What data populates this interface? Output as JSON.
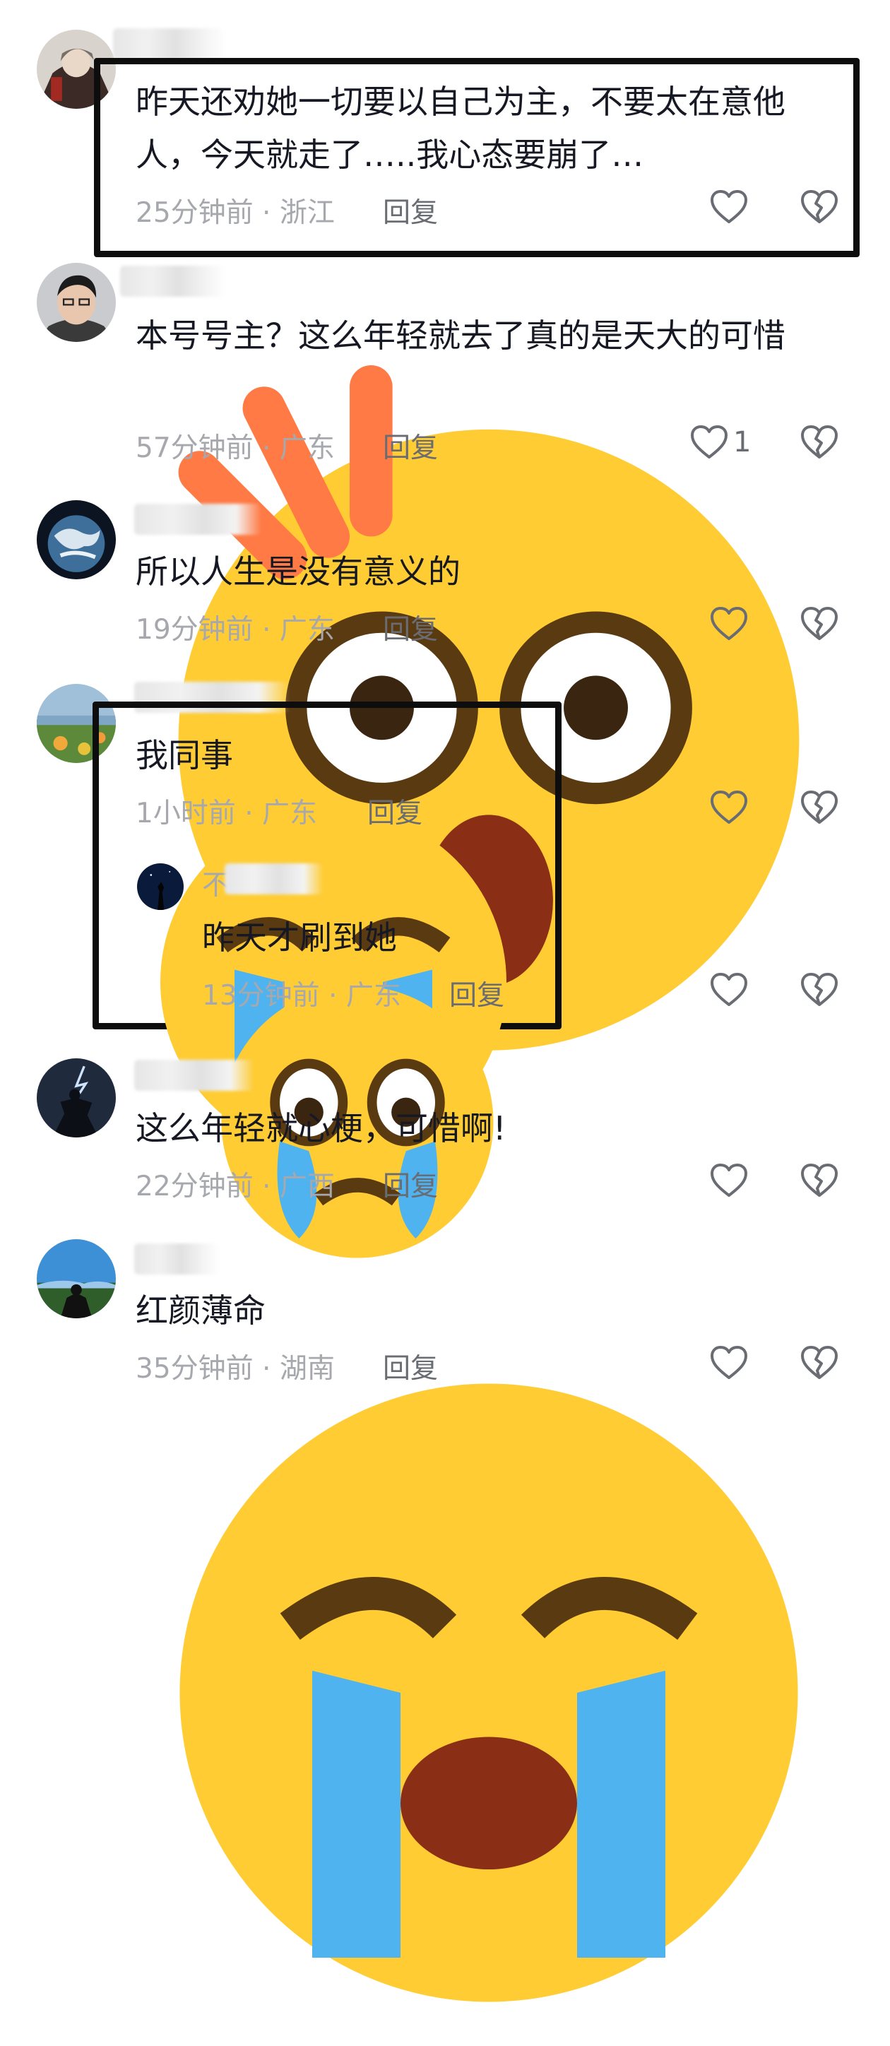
{
  "comments": [
    {
      "text_lines": [
        "昨天还劝她一切要以自己为主，不要太在意他",
        "人，今天就走了…..我心态要崩了…"
      ],
      "time": "25分钟前 · 浙江",
      "reply_label": "回复",
      "like_count": ""
    },
    {
      "text": "本号号主？这么年轻就去了真的是天大的可惜",
      "emoji": "shocked-emoji",
      "time": "57分钟前 · 广东",
      "reply_label": "回复",
      "like_count": "1"
    },
    {
      "text": "所以人生是没有意义的",
      "time": "19分钟前 · 广东",
      "reply_label": "回复",
      "like_count": ""
    },
    {
      "text": "我同事",
      "emoji": "crying-emoji",
      "time": "1小时前 · 广东",
      "reply_label": "回复",
      "like_count": "",
      "sub_reply": {
        "name_partial": "不",
        "text": "昨天才刷到她",
        "emoji": "tearful-emoji",
        "time": "13分钟前 · 广东",
        "reply_label": "回复"
      }
    },
    {
      "text": "这么年轻就心梗，可惜啊!",
      "time": "22分钟前 · 广西",
      "reply_label": "回复",
      "like_count": ""
    },
    {
      "text": "红颜薄命",
      "emoji": "crying-emoji",
      "time": "35分钟前 · 湖南",
      "reply_label": "回复",
      "like_count": ""
    }
  ],
  "icons": {
    "like": "heart-outline-icon",
    "dislike": "broken-heart-icon"
  },
  "colors": {
    "text": "#161823",
    "meta": "#a6a8ad",
    "highlight_frame": "#0d0d0d"
  }
}
